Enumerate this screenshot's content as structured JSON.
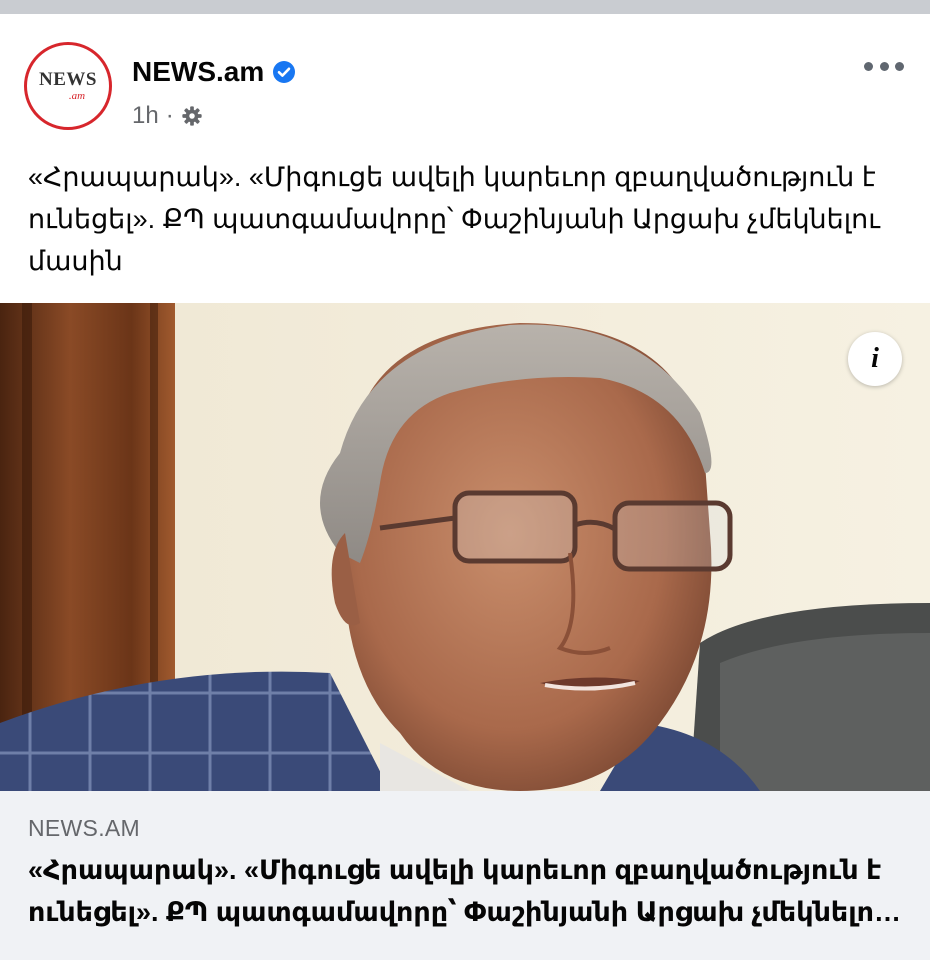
{
  "post": {
    "page_name": "NEWS.am",
    "verified": true,
    "timestamp": "1h",
    "separator": "·",
    "privacy_icon": "gear-icon",
    "more_icon": "more-options-icon",
    "text": "«Հրապարակ». «Միգուցե ավելի կարեւոր զբաղվածություն է ունեցել». ՔՊ պատգամավորը՝ Փաշինյանի Արցախ չմեկնելու մասին"
  },
  "avatar": {
    "logo_main": "NEWS",
    "logo_sub": ".am",
    "ring_color": "#d7262c"
  },
  "image": {
    "info_label": "i"
  },
  "link_preview": {
    "domain": "NEWS.AM",
    "title": "«Հրապարակ». «Միգուցե ավելի կարեւոր զբաղվածություն է ունեցել». ՔՊ պատգամավորը՝ Փաշինյանի Արցախ չմեկնելու մասին"
  },
  "colors": {
    "verified_blue": "#1877f2",
    "preview_bg": "#f0f2f5",
    "secondary_text": "#65676b"
  }
}
